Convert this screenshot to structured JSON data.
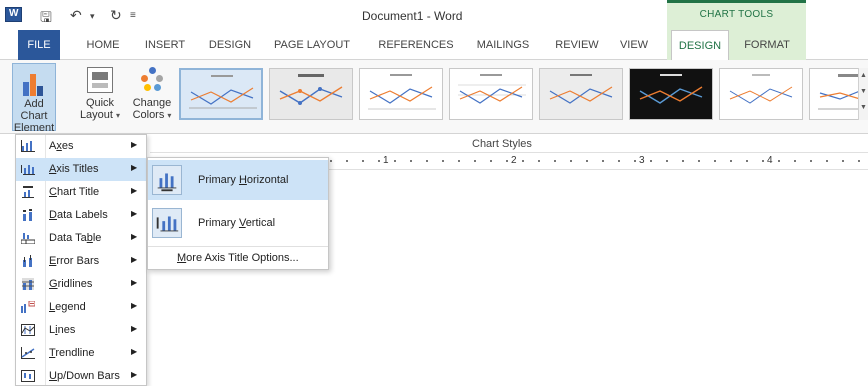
{
  "window": {
    "title": "Document1 - Word",
    "context_group": "CHART TOOLS"
  },
  "quick_access": {
    "save_icon": "save-icon",
    "undo_icon": "undo-icon",
    "redo_icon": "redo-icon"
  },
  "tabs": {
    "file": "FILE",
    "home": "HOME",
    "insert": "INSERT",
    "design": "DESIGN",
    "page_layout": "PAGE LAYOUT",
    "references": "REFERENCES",
    "mailings": "MAILINGS",
    "review": "REVIEW",
    "view": "VIEW",
    "chart_design": "DESIGN",
    "chart_format": "FORMAT"
  },
  "ribbon": {
    "add_chart_line1": "Add Chart",
    "add_chart_line2": "Element",
    "quick_line1": "Quick",
    "quick_line2": "Layout",
    "change_line1": "Change",
    "change_line2": "Colors",
    "group_chart_styles": "Chart Styles"
  },
  "ruler": {
    "numbers": [
      "1",
      "2",
      "3",
      "4"
    ]
  },
  "menu": {
    "items": [
      {
        "label_pre": "A",
        "label_key": "x",
        "label_post": "es",
        "icon": "axes-icon"
      },
      {
        "label_pre": "",
        "label_key": "A",
        "label_post": "xis Titles",
        "icon": "axis-titles-icon"
      },
      {
        "label_pre": "",
        "label_key": "C",
        "label_post": "hart Title",
        "icon": "chart-title-icon"
      },
      {
        "label_pre": "",
        "label_key": "D",
        "label_post": "ata Labels",
        "icon": "data-labels-icon"
      },
      {
        "label_pre": "Data Ta",
        "label_key": "b",
        "label_post": "le",
        "icon": "data-table-icon"
      },
      {
        "label_pre": "",
        "label_key": "E",
        "label_post": "rror Bars",
        "icon": "error-bars-icon"
      },
      {
        "label_pre": "",
        "label_key": "G",
        "label_post": "ridlines",
        "icon": "gridlines-icon"
      },
      {
        "label_pre": "",
        "label_key": "L",
        "label_post": "egend",
        "icon": "legend-icon"
      },
      {
        "label_pre": "L",
        "label_key": "i",
        "label_post": "nes",
        "icon": "lines-icon"
      },
      {
        "label_pre": "",
        "label_key": "T",
        "label_post": "rendline",
        "icon": "trendline-icon"
      },
      {
        "label_pre": "",
        "label_key": "U",
        "label_post": "p/Down Bars",
        "icon": "up-down-bars-icon"
      }
    ]
  },
  "submenu": {
    "primary_horizontal_pre": "Primary ",
    "primary_horizontal_key": "H",
    "primary_horizontal_post": "orizontal",
    "primary_vertical_pre": "Primary ",
    "primary_vertical_key": "V",
    "primary_vertical_post": "ertical",
    "more_pre": "",
    "more_key": "M",
    "more_post": "ore Axis Title Options..."
  },
  "colors": {
    "accent": "#2b579a",
    "chart_tools": "#217346",
    "highlight": "#cde3f7"
  }
}
